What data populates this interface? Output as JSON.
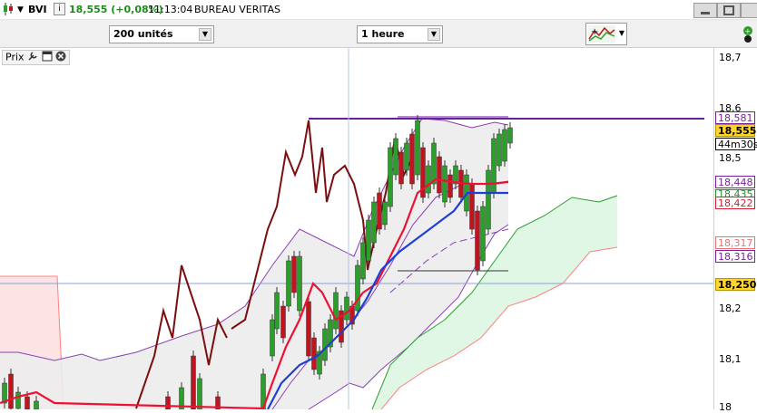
{
  "topbar": {
    "symbol": "BVI",
    "info_badge": "i",
    "price_change": "18,555 (+0,08%)",
    "time": "11:13:04",
    "name": "BUREAU VERITAS"
  },
  "toolbar": {
    "units_value": "200 unités",
    "period_value": "1 heure",
    "indicator_icon": "chart-indicators-icon"
  },
  "panel": {
    "label": "Prix"
  },
  "axis": {
    "ticks": [
      "18,7",
      "18,6",
      "18,5",
      "18,2",
      "18,1",
      "18"
    ],
    "tags": [
      {
        "label": "18,581",
        "color": "#7a1fa0",
        "bg": "#ffffff"
      },
      {
        "label": "18,555",
        "color": "#000000",
        "bg": "#ffd52b"
      },
      {
        "label": "44m30s",
        "color": "#000000",
        "bg": "#ffffff"
      },
      {
        "label": "18,448",
        "color": "#7a1fa0",
        "bg": "#ffffff"
      },
      {
        "label": "18,435",
        "color": "#2b8a2b",
        "bg": "#ffffff"
      },
      {
        "label": "18,422",
        "color": "#d61e2e",
        "bg": "#ffffff"
      },
      {
        "label": "18,317",
        "color": "#f07070",
        "bg": "#ffffff"
      },
      {
        "label": "18,316",
        "color": "#7a1fa0",
        "bg": "#ffffff"
      },
      {
        "label": "18,250",
        "color": "#000000",
        "bg": "#ffd52b"
      }
    ]
  },
  "colors": {
    "up": "#2aa02a",
    "down": "#c0141f",
    "tenkan": "#ee1133",
    "kijun": "#1d3fd6",
    "chikou": "#7a0f0f",
    "bollinger": "#8a3fb5",
    "kumo_bull": "#2e9c2e",
    "kumo_bear": "#ff8080",
    "level": "#6a1fa0"
  }
}
